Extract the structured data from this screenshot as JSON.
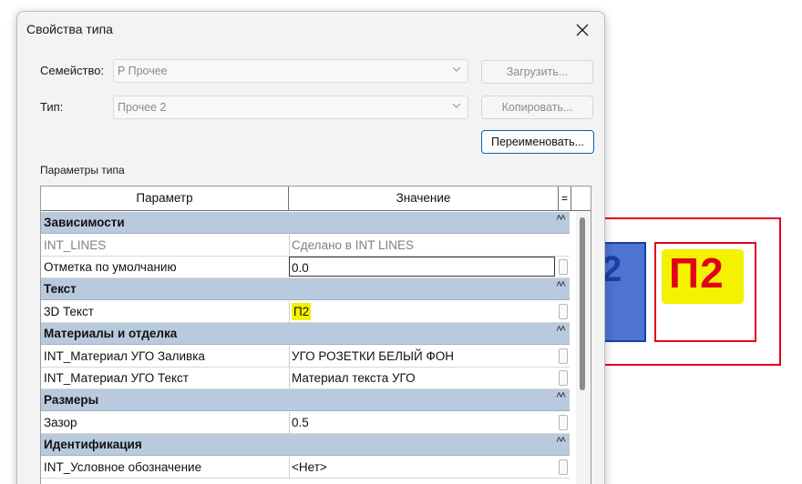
{
  "dialog": {
    "title": "Свойства типа",
    "family_label": "Семейство:",
    "family_value": "P Прочее",
    "type_label": "Тип:",
    "type_value": "Прочее 2",
    "load_button": "Загрузить...",
    "duplicate_button": "Копировать...",
    "rename_button": "Переименовать...",
    "params_caption": "Параметры типа"
  },
  "grid": {
    "col_param": "Параметр",
    "col_value": "Значение",
    "col_eq": "=",
    "rows": [
      {
        "kind": "group",
        "label": "Зависимости"
      },
      {
        "kind": "item",
        "param": "INT_LINES",
        "value": "Сделано в INT LINES",
        "muted": true
      },
      {
        "kind": "item",
        "param": "Отметка по умолчанию",
        "value": "0.0",
        "editing": true
      },
      {
        "kind": "group",
        "label": "Текст"
      },
      {
        "kind": "item",
        "param": "3D Текст",
        "value": "П2",
        "highlight": true
      },
      {
        "kind": "group",
        "label": "Материалы и отделка"
      },
      {
        "kind": "item",
        "param": "INT_Материал УГО Заливка",
        "value": "УГО РОЗЕТКИ БЕЛЫЙ ФОН"
      },
      {
        "kind": "item",
        "param": "INT_Материал УГО Текст",
        "value": "Материал текста УГО"
      },
      {
        "kind": "group",
        "label": "Размеры"
      },
      {
        "kind": "item",
        "param": "Зазор",
        "value": "0.5"
      },
      {
        "kind": "group",
        "label": "Идентификация"
      },
      {
        "kind": "item",
        "param": "INT_Условное обозначение",
        "value": "<Нет>"
      }
    ]
  },
  "canvas": {
    "blue_tag_text": "2",
    "red_tag_text": "П2"
  },
  "colors": {
    "group_row": "#b9cade",
    "accent_border": "#0a5fb4",
    "highlight": "#f5f200",
    "tag_red": "#e3001b",
    "tag_blue": "#4c74d0"
  }
}
